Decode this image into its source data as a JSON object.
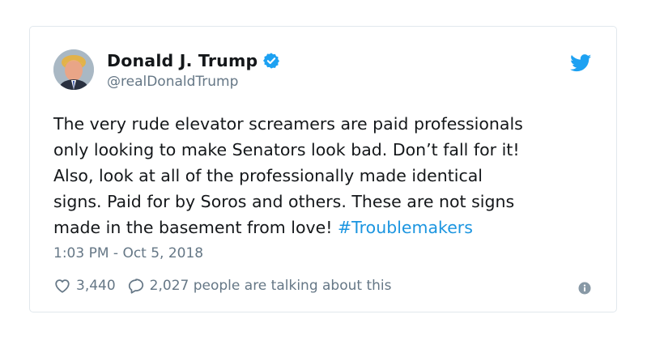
{
  "tweet": {
    "author": {
      "display_name": "Donald J. Trump",
      "handle": "@realDonaldTrump",
      "verified": true,
      "avatar": "profile-photo"
    },
    "text_lines": [
      "The very rude elevator screamers are paid professionals",
      "only looking to make Senators look bad. Don’t fall for it!",
      "Also, look at all of the professionally made identical",
      "signs. Paid for by Soros and others. These are not signs",
      "made in the basement from love!"
    ],
    "hashtag": "#Troublemakers",
    "timestamp": "1:03 PM - Oct 5, 2018",
    "likes": "3,440",
    "talking_text": "2,027 people are talking about this"
  },
  "icons": {
    "brand": "twitter-bird-icon",
    "verified": "verified-badge-icon",
    "like": "heart-icon",
    "reply": "speech-bubble-icon",
    "info": "info-icon"
  },
  "colors": {
    "brand_blue": "#1da1f2",
    "link_blue": "#1b95e0",
    "secondary_text": "#657786",
    "border": "#e1e8ed"
  }
}
